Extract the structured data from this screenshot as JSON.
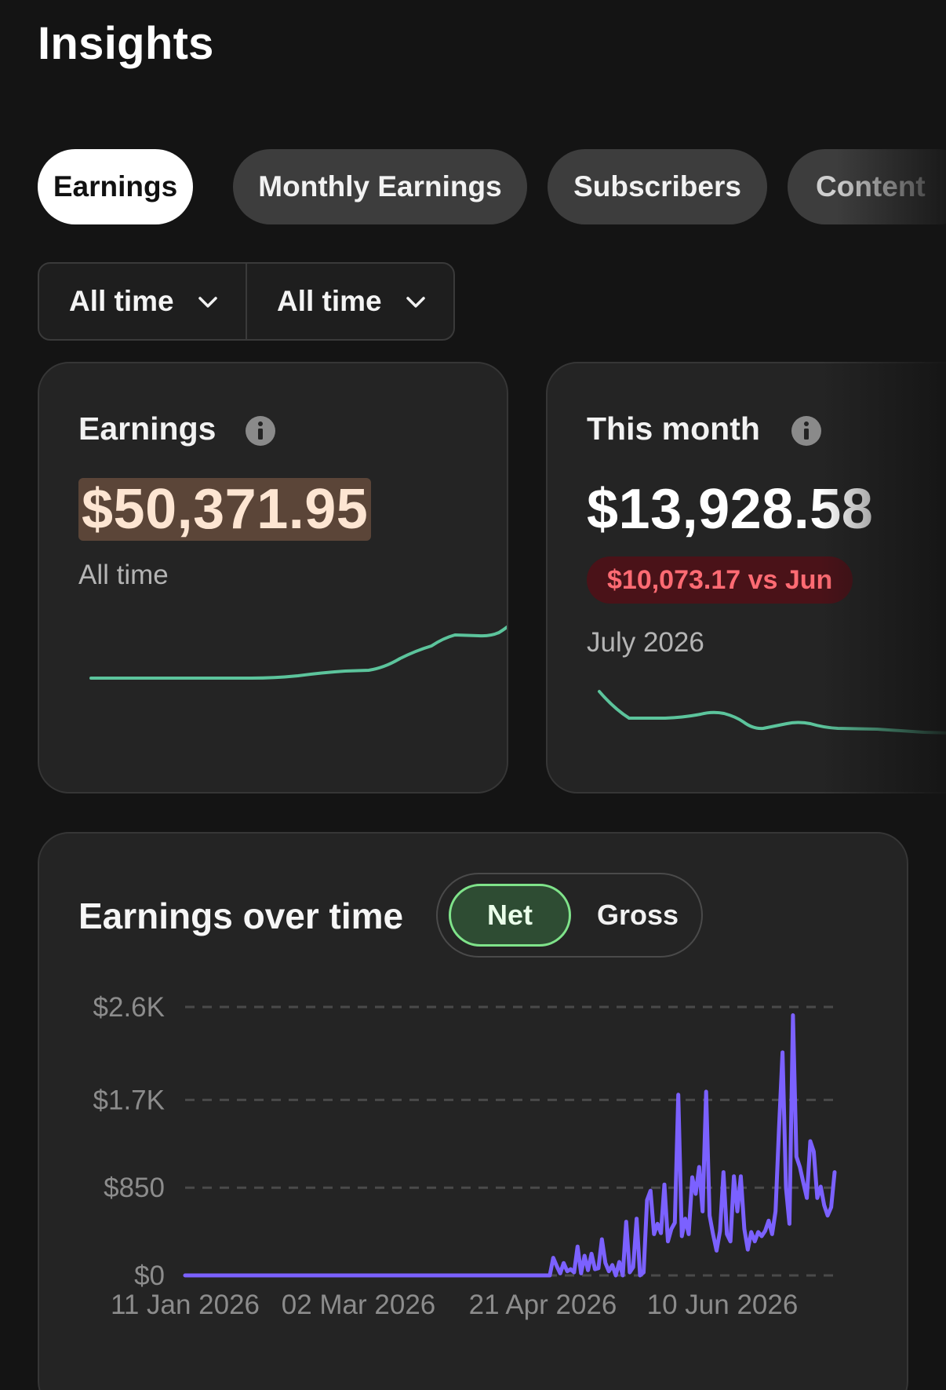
{
  "page": {
    "title": "Insights"
  },
  "tabs": [
    {
      "label": "Earnings",
      "active": true
    },
    {
      "label": "Monthly Earnings",
      "active": false
    },
    {
      "label": "Subscribers",
      "active": false
    },
    {
      "label": "Content",
      "active": false
    }
  ],
  "filters": [
    {
      "label": "All time",
      "icon": "chevron-down-icon"
    },
    {
      "label": "All time",
      "icon": "chevron-down-icon"
    }
  ],
  "cards": {
    "earnings": {
      "label": "Earnings",
      "value": "$50,371.95",
      "period": "All time",
      "icon": "info-icon"
    },
    "this_month": {
      "label": "This month",
      "value": "$13,928.58",
      "change_badge": "$10,073.17 vs Jun",
      "period": "July 2026",
      "icon": "info-icon"
    }
  },
  "earnings_chart": {
    "title": "Earnings over time",
    "toggle": {
      "options": [
        "Net",
        "Gross"
      ],
      "selected": "Net"
    }
  },
  "colors": {
    "background": "#141414",
    "card": "#242424",
    "sparkline": "#5cc49c",
    "series": "#7b61ff",
    "badge_text": "#ff6b73",
    "toggle_active_border": "#7fe38a"
  },
  "chart_data": {
    "type": "line",
    "title": "Earnings over time",
    "ylabel": "",
    "xlabel": "",
    "y_ticks": [
      "$0",
      "$850",
      "$1.7K",
      "$2.6K"
    ],
    "y_tick_values": [
      0,
      850,
      1700,
      2600
    ],
    "x_ticks": [
      "11 Jan 2026",
      "02 Mar 2026",
      "21 Apr 2026",
      "10 Jun 2026"
    ],
    "ylim": [
      0,
      2600
    ],
    "grid": true,
    "x_start": "2026-01-11",
    "series": [
      {
        "values": [
          0,
          0,
          0,
          0,
          0,
          0,
          0,
          0,
          0,
          0,
          0,
          0,
          0,
          0,
          0,
          0,
          0,
          0,
          0,
          0,
          0,
          0,
          0,
          0,
          0,
          0,
          0,
          0,
          0,
          0,
          0,
          0,
          0,
          0,
          0,
          0,
          0,
          0,
          0,
          0,
          0,
          0,
          0,
          0,
          0,
          0,
          0,
          0,
          0,
          0,
          0,
          0,
          0,
          0,
          0,
          0,
          0,
          0,
          0,
          0,
          0,
          0,
          0,
          0,
          0,
          0,
          0,
          0,
          0,
          0,
          0,
          0,
          0,
          0,
          0,
          0,
          0,
          0,
          0,
          0,
          0,
          0,
          0,
          0,
          0,
          0,
          0,
          0,
          0,
          0,
          0,
          0,
          0,
          0,
          0,
          0,
          0,
          0,
          0,
          0,
          0,
          0,
          0,
          0,
          0,
          0,
          170,
          90,
          20,
          120,
          40,
          60,
          30,
          280,
          20,
          190,
          50,
          210,
          60,
          70,
          350,
          120,
          40,
          100,
          0,
          130,
          0,
          520,
          30,
          80,
          550,
          0,
          30,
          730,
          820,
          400,
          500,
          410,
          880,
          330,
          450,
          510,
          1750,
          380,
          550,
          400,
          950,
          790,
          1050,
          620,
          1780,
          580,
          400,
          240,
          430,
          1000,
          400,
          330,
          960,
          620,
          960,
          450,
          250,
          420,
          330,
          420,
          380,
          430,
          530,
          400,
          620,
          1440,
          2160,
          850,
          500,
          2520,
          1150,
          1050,
          900,
          750,
          1300,
          1200,
          750,
          860,
          680,
          580,
          660,
          1000
        ],
        "x_start_day": 0,
        "note_start": "sequence spans 11 Jan 2026 to early July 2026, one value per day"
      }
    ]
  }
}
